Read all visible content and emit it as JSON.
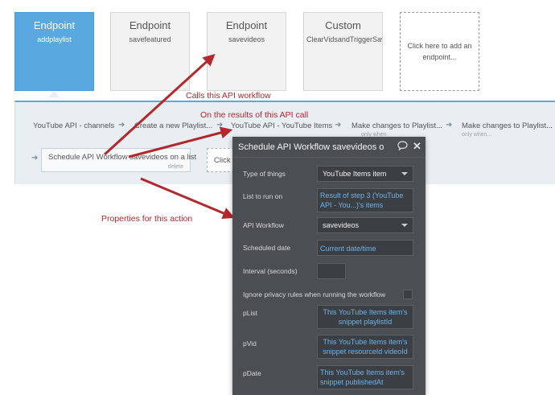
{
  "endpoints": [
    {
      "type": "Endpoint",
      "name": "addplaylist"
    },
    {
      "type": "Endpoint",
      "name": "savefeatured"
    },
    {
      "type": "Endpoint",
      "name": "savevideos"
    },
    {
      "type": "Custom",
      "name": "ClearVidsandTriggerSav"
    }
  ],
  "add_endpoint_label": "Click here to add an endpoint...",
  "workflow_steps": [
    {
      "label": "YouTube API - channels"
    },
    {
      "label": "Create a new Playlist..."
    },
    {
      "label": "YouTube API - YouTube Items"
    },
    {
      "label": "Make changes to Playlist...",
      "sub": "only when"
    },
    {
      "label": "Make changes to Playlist...",
      "sub": "only when..."
    }
  ],
  "current_step": {
    "label": "Schedule API Workflow savevideos on a list",
    "delete_label": "delete"
  },
  "next_step_label": "Click h",
  "annotations": {
    "calls": "Calls this API workflow",
    "results": "On the results of this API call",
    "properties": "Properties for this action"
  },
  "colors": {
    "annotation": "#b2282d",
    "active_endpoint": "#59a8e0",
    "panel_bg": "#4b4f53",
    "link_text": "#6fb3ea"
  },
  "panel": {
    "title": "Schedule API Workflow savevideos o",
    "icons": [
      "comment-icon",
      "close-icon"
    ],
    "type_of_things": {
      "label": "Type of things",
      "value": "YouTube Items item"
    },
    "list_to_run_on": {
      "label": "List to run on",
      "value": "Result of step 3 (YouTube API - You...)'s items"
    },
    "api_workflow": {
      "label": "API Workflow",
      "value": "savevideos"
    },
    "scheduled_date": {
      "label": "Scheduled date",
      "value": "Current date/time"
    },
    "interval": {
      "label": "Interval (seconds)",
      "value": ""
    },
    "ignore_privacy": {
      "label": "Ignore privacy rules when running the workflow",
      "checked": false
    },
    "plist": {
      "label": "pList",
      "value": "This YouTube Items item's snippet playlistId"
    },
    "pvid": {
      "label": "pVid",
      "value": "This YouTube Items item's snippet resourceId videoId"
    },
    "pdate": {
      "label": "pDate",
      "value": "This YouTube Items item's snippet publishedAt"
    }
  }
}
